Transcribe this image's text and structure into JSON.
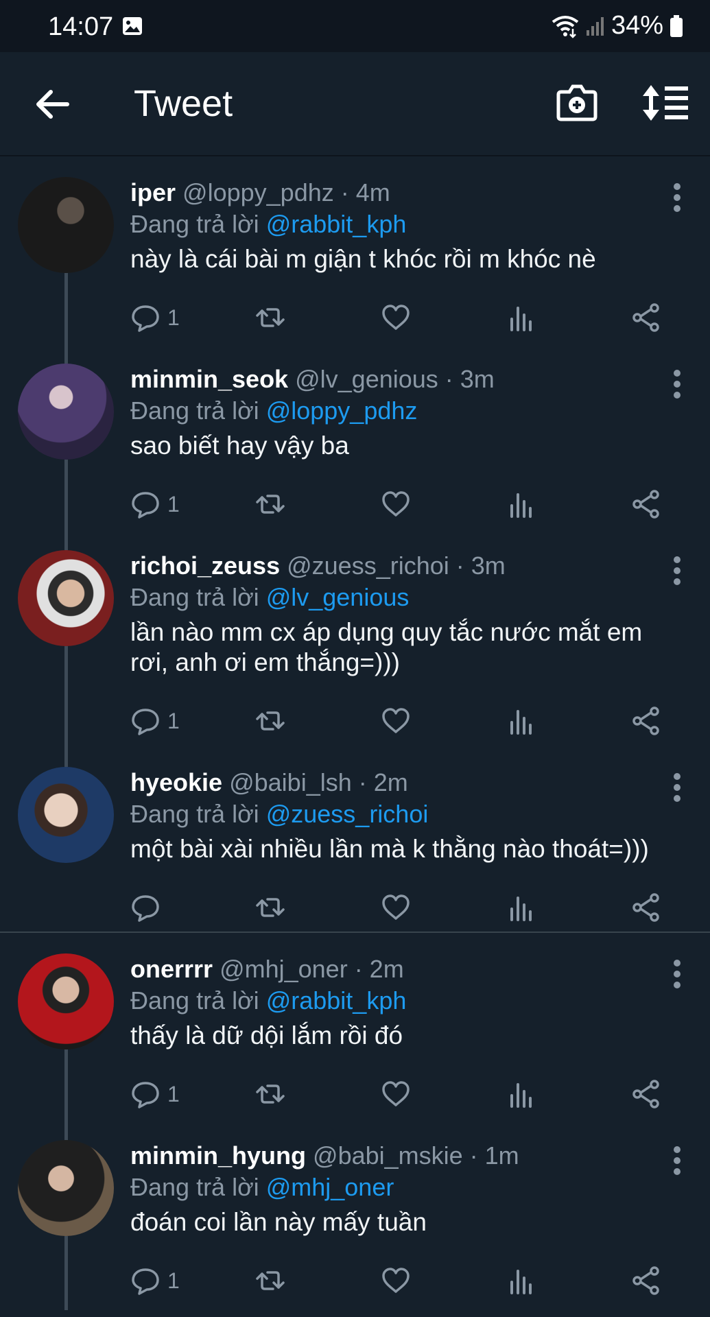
{
  "status": {
    "time": "14:07",
    "battery": "34%"
  },
  "header": {
    "title": "Tweet"
  },
  "tweets": [
    {
      "name": "iper",
      "handle": "@loppy_pdhz · 4m",
      "reply_prefix": "Đang trả lời",
      "reply_to": "@rabbit_kph",
      "text": "này là cái bài m giận t khóc rồi m khóc nè",
      "reply_count": "1"
    },
    {
      "name": "minmin_seok",
      "handle": "@lv_genious · 3m",
      "reply_prefix": "Đang trả lời",
      "reply_to": "@loppy_pdhz",
      "text": "sao biết hay vậy ba",
      "reply_count": "1"
    },
    {
      "name": "richoi_zeuss",
      "handle": "@zuess_richoi · 3m",
      "reply_prefix": "Đang trả lời",
      "reply_to": "@lv_genious",
      "text": "lần nào mm cx áp dụng quy tắc nước mắt em rơi, anh ơi em thắng=)))",
      "reply_count": "1"
    },
    {
      "name": "hyeokie",
      "handle": "@baibi_lsh · 2m",
      "reply_prefix": "Đang trả lời",
      "reply_to": "@zuess_richoi",
      "text": "một bài xài nhiều lần mà k thằng nào thoát=)))",
      "reply_count": ""
    },
    {
      "name": "onerrrr",
      "handle": "@mhj_oner · 2m",
      "reply_prefix": "Đang trả lời",
      "reply_to": "@rabbit_kph",
      "text": "thấy là dữ dội lắm rồi đó",
      "reply_count": "1"
    },
    {
      "name": "minmin_hyung",
      "handle": "@babi_mskie · 1m",
      "reply_prefix": "Đang trả lời",
      "reply_to": "@mhj_oner",
      "text": "đoán coi lần này mấy tuần",
      "reply_count": "1"
    }
  ],
  "colors": {
    "background": "#15202b",
    "accent": "#1d9bf0",
    "muted": "#8b98a5"
  }
}
